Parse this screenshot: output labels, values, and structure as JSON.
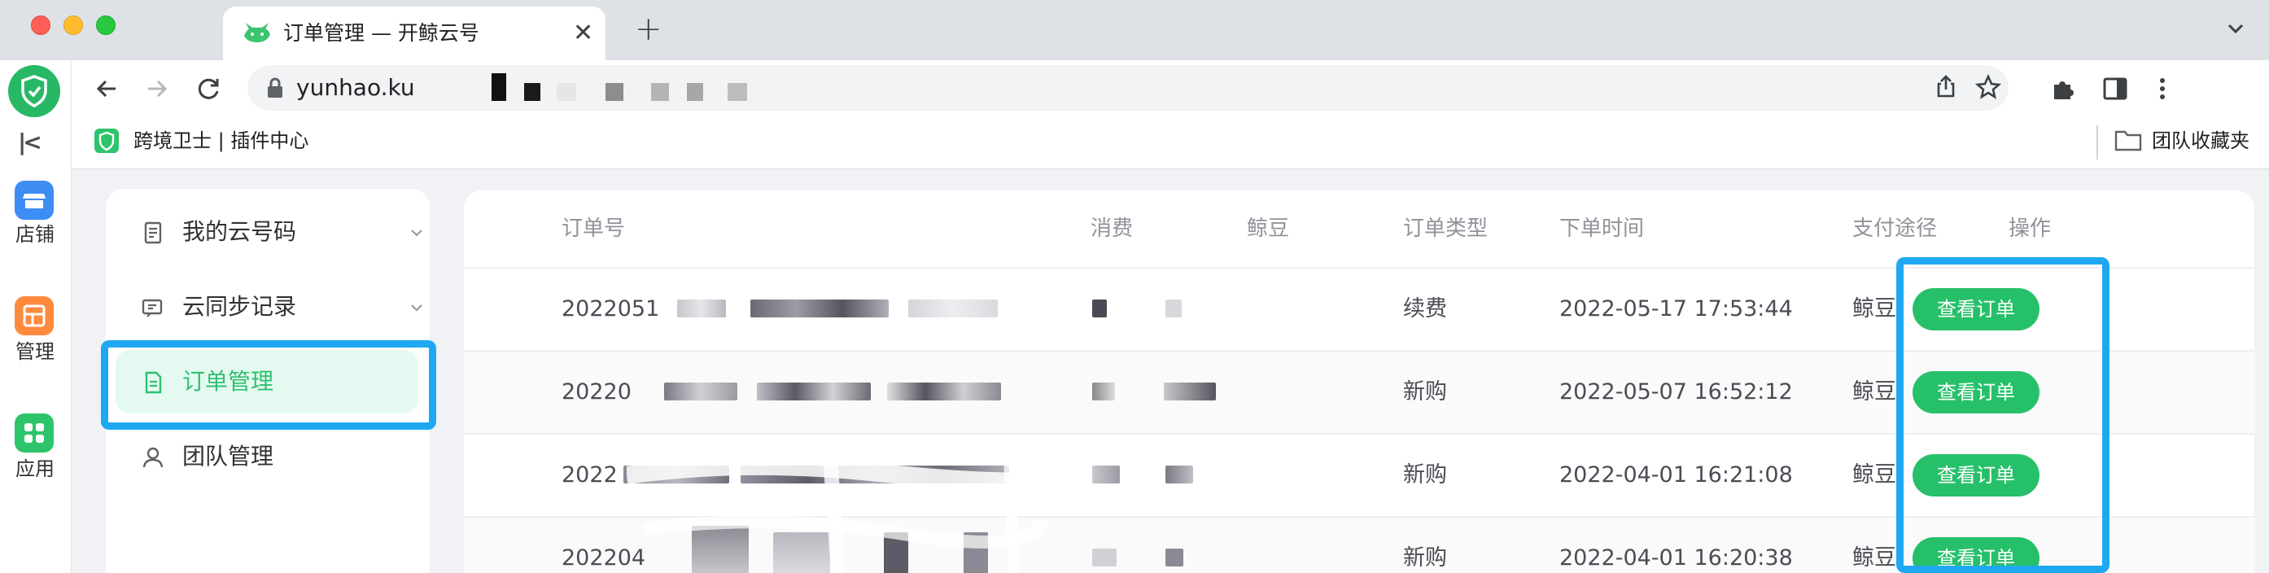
{
  "browser": {
    "tab_title": "订单管理 — 开鲸云号",
    "new_tab": "+",
    "close_tab": "✕",
    "url_visible": "yunhao.ku"
  },
  "bookmarks": {
    "item_label": "跨境卫士 | 插件中心",
    "folder_label": "团队收藏夹"
  },
  "rail": {
    "collapse": "|<",
    "items": [
      {
        "label": "店铺",
        "color": "#3d8df5"
      },
      {
        "label": "管理",
        "color": "#ff8a3d"
      },
      {
        "label": "应用",
        "color": "#2ec46b"
      }
    ]
  },
  "menu": {
    "items": [
      {
        "label": "我的云号码",
        "active": false
      },
      {
        "label": "云同步记录",
        "active": false
      },
      {
        "label": "订单管理",
        "active": true
      },
      {
        "label": "团队管理",
        "active": false
      }
    ]
  },
  "table": {
    "headers": [
      "订单号",
      "消费",
      "鲸豆",
      "订单类型",
      "下单时间",
      "支付途径",
      "操作"
    ],
    "rows": [
      {
        "order_no": "2022051",
        "type": "续费",
        "time": "2022-05-17 17:53:44",
        "pay": "鲸豆",
        "action": "查看订单"
      },
      {
        "order_no": "20220",
        "type": "新购",
        "time": "2022-05-07 16:52:12",
        "pay": "鲸豆",
        "action": "查看订单"
      },
      {
        "order_no": "2022",
        "type": "新购",
        "time": "2022-04-01 16:21:08",
        "pay": "鲸豆",
        "action": "查看订单"
      },
      {
        "order_no": "202204",
        "type": "新购",
        "time": "2022-04-01 16:20:38",
        "pay": "鲸豆",
        "action": "查看订单"
      }
    ]
  },
  "colors": {
    "brand_green": "#27c06a",
    "highlight_blue": "#1fa8f2",
    "active_menu_bg": "#e4faf0"
  }
}
